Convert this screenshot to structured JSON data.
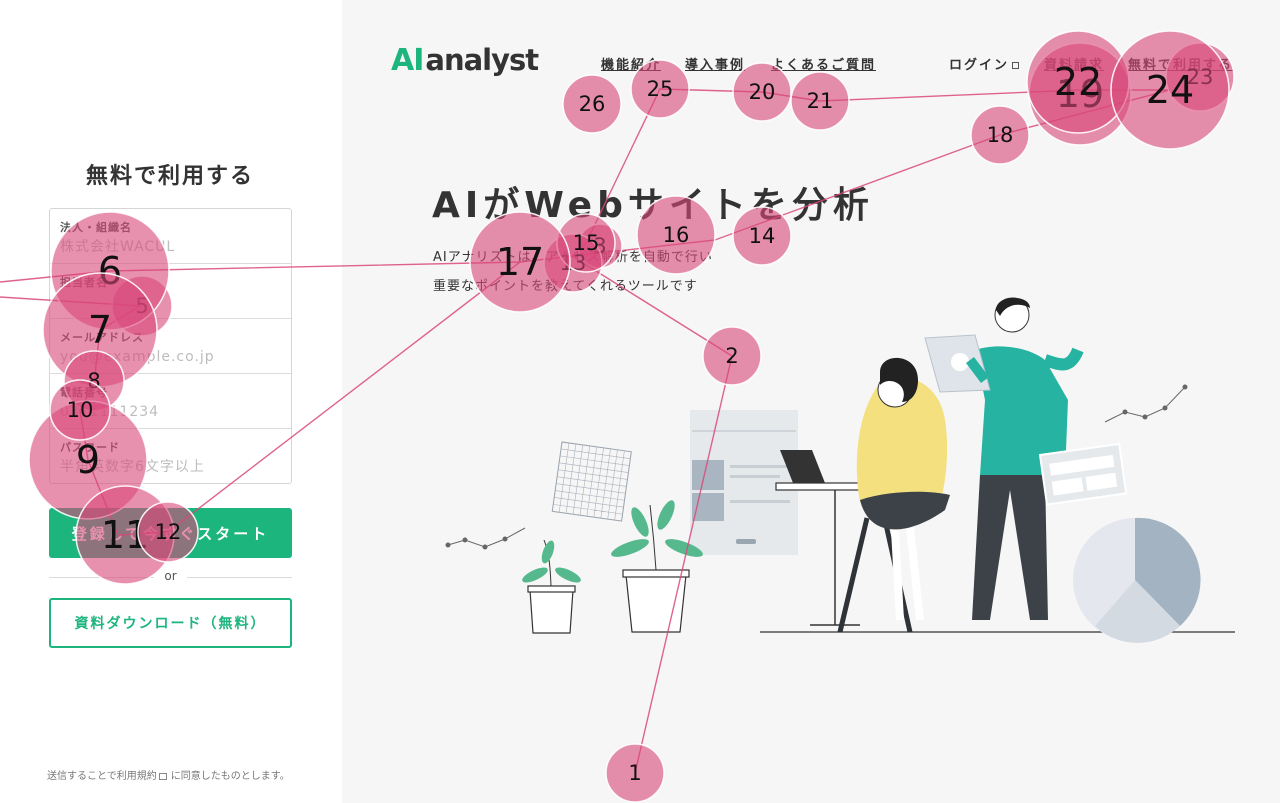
{
  "header": {
    "logo_accent": "AI",
    "logo_rest": "analyst",
    "nav": {
      "features": "機能紹介",
      "cases": "導入事例",
      "faq": "よくあるご質問",
      "login": "ログイン",
      "request_docs": "資料請求",
      "free_trial": "無料で利用する"
    }
  },
  "signup_form": {
    "title": "無料で利用する",
    "fields": [
      {
        "label": "法人・組織名",
        "placeholder": "株式会社WACUL"
      },
      {
        "label": "担当者名",
        "placeholder": ""
      },
      {
        "label": "メールアドレス",
        "placeholder": "you@example.co.jp"
      },
      {
        "label": "電話番号",
        "placeholder": "0311111234"
      },
      {
        "label": "パスワード",
        "placeholder": "半角英数字6文字以上"
      }
    ],
    "submit_label": "登録して今すぐスタート",
    "divider_text": "or",
    "download_label": "資料ダウンロード（無料）",
    "terms_prefix": "送信することで",
    "terms_link": "利用規約",
    "terms_suffix": "に同意したものとします。"
  },
  "hero": {
    "title": "AIがWebサイトを分析",
    "subtitle_line1": "AIアナリストは、アクセス解析を自動で行い",
    "subtitle_line2": "重要なポイントを教えてくれるツールです"
  },
  "colors": {
    "brand_green": "#1cb57e",
    "heatmap_marker": "#d9487a",
    "teal_shirt": "#26b3a1",
    "yellow_sweater": "#f4e07f"
  },
  "heatmap": {
    "fixations": [
      {
        "n": "1"
      },
      {
        "n": "2"
      },
      {
        "n": "3"
      },
      {
        "n": "5"
      },
      {
        "n": "6"
      },
      {
        "n": "7"
      },
      {
        "n": "8"
      },
      {
        "n": "9"
      },
      {
        "n": "10"
      },
      {
        "n": "11"
      },
      {
        "n": "12"
      },
      {
        "n": "13"
      },
      {
        "n": "14"
      },
      {
        "n": "15"
      },
      {
        "n": "16"
      },
      {
        "n": "17"
      },
      {
        "n": "18"
      },
      {
        "n": "19"
      },
      {
        "n": "20"
      },
      {
        "n": "21"
      },
      {
        "n": "22"
      },
      {
        "n": "23"
      },
      {
        "n": "24"
      },
      {
        "n": "25"
      },
      {
        "n": "26"
      }
    ]
  }
}
